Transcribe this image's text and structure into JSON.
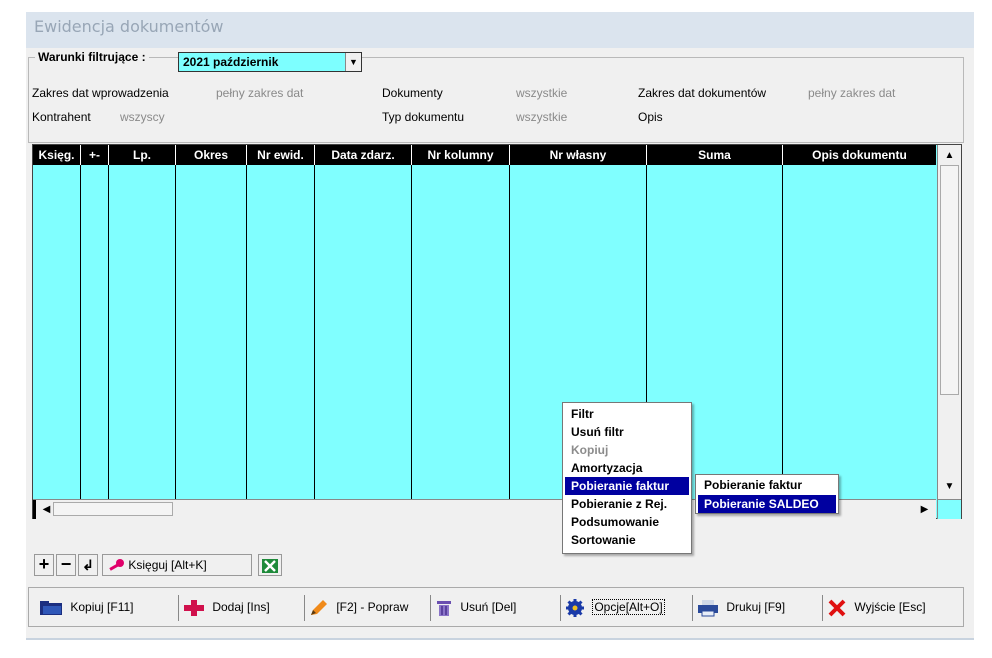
{
  "window": {
    "title": "Ewidencja dokumentów"
  },
  "filter": {
    "legend": "Warunki filtrujące :",
    "selected": "2021 październik",
    "rows": [
      {
        "label": "Zakres dat  wprowadzenia",
        "value": "pełny zakres dat"
      },
      {
        "label": "Dokumenty",
        "value": "wszystkie"
      },
      {
        "label": "Zakres dat  dokumentów",
        "value": "pełny zakres dat"
      },
      {
        "label": "Kontrahent",
        "value": "wszyscy"
      },
      {
        "label": "Typ dokumentu",
        "value": "wszystkie"
      },
      {
        "label": "Opis",
        "value": ""
      }
    ]
  },
  "table": {
    "columns": [
      "Księg.",
      "+-",
      "Lp.",
      "Okres",
      "Nr ewid.",
      "Data zdarz.",
      "Nr kolumny",
      "Nr własny",
      "Suma",
      "Opis dokumentu"
    ],
    "rows": []
  },
  "context_menu": {
    "items": [
      {
        "label": "Filtr",
        "state": "normal"
      },
      {
        "label": "Usuń filtr",
        "state": "normal"
      },
      {
        "label": "Kopiuj",
        "state": "disabled"
      },
      {
        "label": "Amortyzacja",
        "state": "normal"
      },
      {
        "label": "Pobieranie faktur",
        "state": "active"
      },
      {
        "label": "Pobieranie z Rej.",
        "state": "normal"
      },
      {
        "label": "Podsumowanie",
        "state": "normal"
      },
      {
        "label": "Sortowanie",
        "state": "normal"
      }
    ],
    "submenu": [
      {
        "label": "Pobieranie faktur",
        "state": "normal"
      },
      {
        "label": "Pobieranie SALDEO",
        "state": "active"
      }
    ]
  },
  "mini_toolbar": {
    "ksieguj_label": "Księguj [Alt+K]"
  },
  "toolbar": {
    "kopiuj": "Kopiuj  [F11]",
    "dodaj": "Dodaj  [Ins]",
    "popraw": "[F2] - Popraw",
    "usun": "Usuń  [Del]",
    "opcje": "Opcje[Alt+O]",
    "drukuj": "Drukuj  [F9]",
    "wyjscie": "Wyjście  [Esc]"
  },
  "colors": {
    "grid": "#80ffff",
    "header": "#000000",
    "highlight": "#0000a0",
    "accent_red": "#e0004a"
  }
}
